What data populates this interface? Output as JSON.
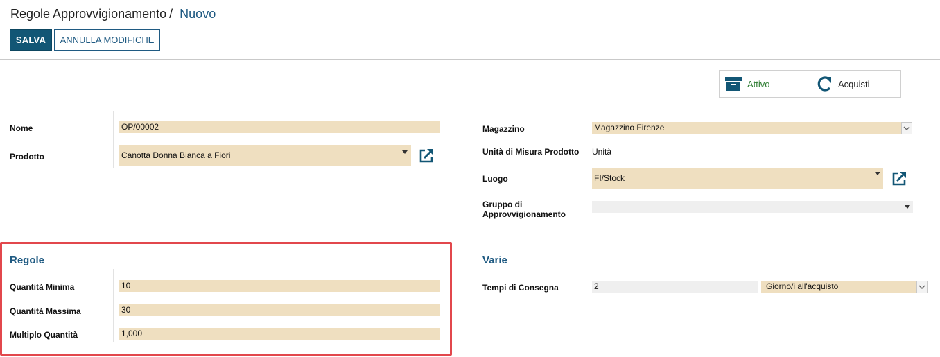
{
  "header": {
    "breadcrumb_parent": "Regole Approvvigionamento",
    "breadcrumb_separator": "/",
    "breadcrumb_current": "Nuovo",
    "save_label": "SALVA",
    "discard_label": "ANNULLA MODIFICHE"
  },
  "smart_buttons": {
    "active_label": "Attivo",
    "active_icon": "archive-icon",
    "purchase_label": "Acquisti",
    "purchase_icon": "refresh-icon"
  },
  "left_fields": {
    "name_label": "Nome",
    "name_value": "OP/00002",
    "product_label": "Prodotto",
    "product_value": "Canotta Donna Bianca a Fiori"
  },
  "right_fields": {
    "warehouse_label": "Magazzino",
    "warehouse_value": "Magazzino Firenze",
    "uom_label": "Unità di Misura Prodotto",
    "uom_value": "Unità",
    "location_label": "Luogo",
    "location_value": "FI/Stock",
    "group_label_line1": "Gruppo di",
    "group_label_line2": "Approvvigionamento",
    "group_value": ""
  },
  "rules_section": {
    "title": "Regole",
    "min_qty_label": "Quantità Minima",
    "min_qty_value": "10",
    "max_qty_label": "Quantità Massima",
    "max_qty_value": "30",
    "multiple_label": "Multiplo Quantità",
    "multiple_value": "1,000"
  },
  "misc_section": {
    "title": "Varie",
    "lead_time_label": "Tempi di Consegna",
    "lead_time_value": "2",
    "lead_time_unit": "Giorno/i all'acquisto"
  },
  "colors": {
    "primary": "#125675",
    "link": "#1f5a82",
    "field_bg": "#efdfc0",
    "highlight": "#e2474c",
    "active_green": "#2e7d32"
  }
}
